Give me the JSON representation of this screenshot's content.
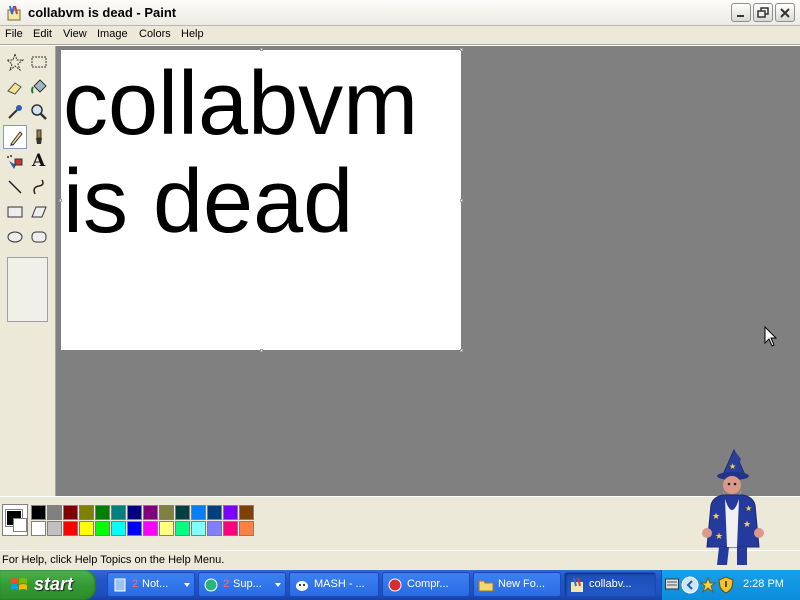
{
  "window": {
    "title": "collabvm is dead - Paint",
    "controls": [
      "minimize",
      "restore",
      "close"
    ]
  },
  "menu": {
    "items": [
      {
        "label": "File"
      },
      {
        "label": "Edit"
      },
      {
        "label": "View"
      },
      {
        "label": "Image"
      },
      {
        "label": "Colors"
      },
      {
        "label": "Help"
      }
    ]
  },
  "toolbox": {
    "tools": [
      {
        "name": "free-form-select",
        "icon": "star-select-icon"
      },
      {
        "name": "select",
        "icon": "rect-select-icon"
      },
      {
        "name": "eraser",
        "icon": "eraser-icon"
      },
      {
        "name": "fill-with-color",
        "icon": "paint-bucket-icon"
      },
      {
        "name": "pick-color",
        "icon": "eyedropper-icon"
      },
      {
        "name": "magnifier",
        "icon": "magnifier-icon"
      },
      {
        "name": "pencil",
        "icon": "pencil-icon",
        "selected": true
      },
      {
        "name": "brush",
        "icon": "brush-icon"
      },
      {
        "name": "airbrush",
        "icon": "airbrush-icon"
      },
      {
        "name": "text",
        "icon": "text-icon"
      },
      {
        "name": "line",
        "icon": "line-icon"
      },
      {
        "name": "curve",
        "icon": "curve-icon"
      },
      {
        "name": "rectangle",
        "icon": "rectangle-icon"
      },
      {
        "name": "polygon",
        "icon": "polygon-icon"
      },
      {
        "name": "ellipse",
        "icon": "ellipse-icon"
      },
      {
        "name": "rounded-rectangle",
        "icon": "rounded-rect-icon"
      }
    ],
    "text_tool_glyph": "A"
  },
  "canvas": {
    "lines": [
      "collabvm",
      "is dead"
    ],
    "background": "#ffffff",
    "text_color": "#000000"
  },
  "palette": {
    "foreground": "#000000",
    "background": "#ffffff",
    "top_row": [
      "#000000",
      "#808080",
      "#800000",
      "#808000",
      "#008000",
      "#008080",
      "#000080",
      "#800080",
      "#808040",
      "#004040",
      "#0080ff",
      "#004080",
      "#8000ff",
      "#804000"
    ],
    "bottom_row": [
      "#ffffff",
      "#c0c0c0",
      "#ff0000",
      "#ffff00",
      "#00ff00",
      "#00ffff",
      "#0000ff",
      "#ff00ff",
      "#ffff80",
      "#00ff80",
      "#80ffff",
      "#8080ff",
      "#ff0080",
      "#ff8040"
    ]
  },
  "status": {
    "text": "For Help, click Help Topics on the Help Menu."
  },
  "taskbar": {
    "start_label": "start",
    "tasks": [
      {
        "label": "Not...",
        "count": "2",
        "icon": "notepad-icon",
        "group": true
      },
      {
        "label": "Sup...",
        "count": "2",
        "icon": "support-icon",
        "group": true
      },
      {
        "label": "MASH - ...",
        "icon": "mash-icon"
      },
      {
        "label": "Compr...",
        "icon": "compress-icon"
      },
      {
        "label": "New Fo...",
        "icon": "folder-icon"
      },
      {
        "label": "collabv...",
        "icon": "paint-icon",
        "active": true
      }
    ],
    "clock": "2:28 PM",
    "tray_icons": [
      "keyboard-icon",
      "chevron-left-icon",
      "network-icon",
      "shield-icon"
    ]
  },
  "colors": {
    "workspace": "#808080",
    "taskbar": "#245edb",
    "start": "#3c9a3c"
  }
}
